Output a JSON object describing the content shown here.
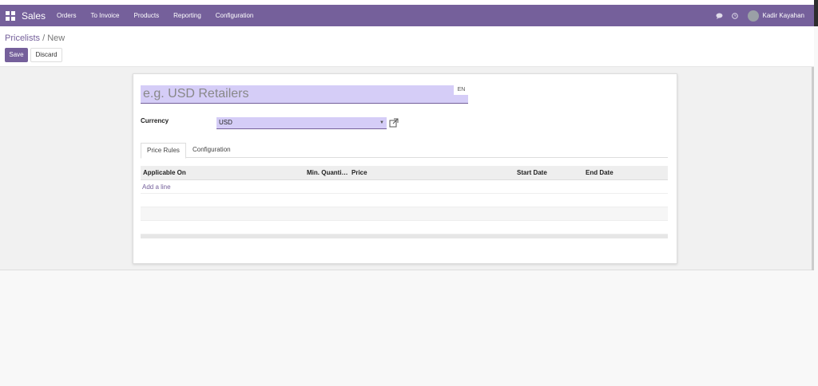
{
  "navbar": {
    "brand": "Sales",
    "menu": [
      "Orders",
      "To Invoice",
      "Products",
      "Reporting",
      "Configuration"
    ],
    "user": "Kadir Kayahan"
  },
  "breadcrumb": {
    "parent": "Pricelists",
    "separator": "/",
    "current": "New"
  },
  "buttons": {
    "save": "Save",
    "discard": "Discard"
  },
  "form": {
    "name_placeholder": "e.g. USD Retailers",
    "lang": "EN",
    "currency_label": "Currency",
    "currency_value": "USD"
  },
  "tabs": [
    "Price Rules",
    "Configuration"
  ],
  "table": {
    "columns": [
      "Applicable On",
      "Min. Quanti…",
      "Price",
      "Start Date",
      "End Date"
    ],
    "add_line": "Add a line"
  },
  "colors": {
    "brand": "#75609b",
    "field_bg": "#d5cdf7"
  },
  "icons": [
    "apps-icon",
    "chat-icon",
    "clock-icon",
    "external-link-icon",
    "dropdown-caret-icon"
  ]
}
